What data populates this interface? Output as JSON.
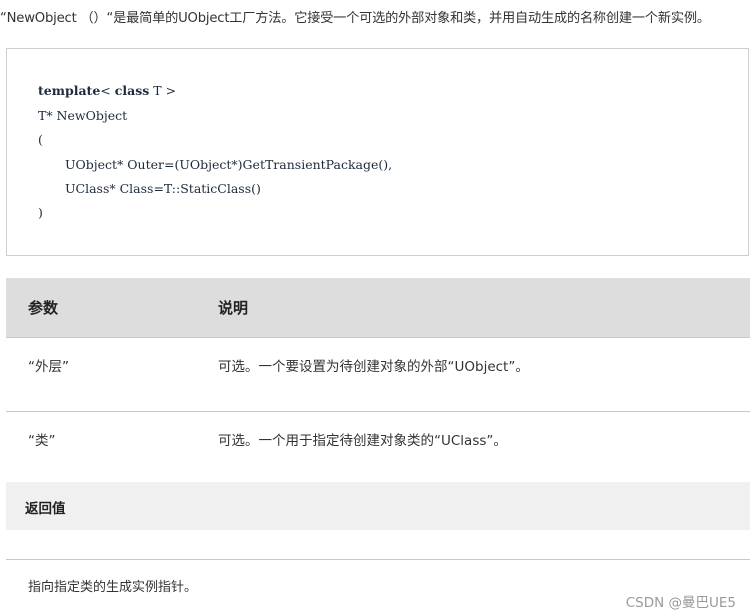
{
  "intro": "“NewObject （）“是最简单的UObject工厂方法。它接受一个可选的外部对象和类，并用自动生成的名称创建一个新实例。",
  "code": {
    "line1_kw1": "template",
    "line1_mid": "< ",
    "line1_kw2": "class",
    "line1_end": " T >",
    "line2": "T* NewObject",
    "line3": "(",
    "line4": "UObject* Outer=(UObject*)GetTransientPackage(),",
    "line5": "UClass* Class=T::StaticClass()",
    "line6": ")"
  },
  "params": {
    "header_param": "参数",
    "header_desc": "说明",
    "rows": [
      {
        "name": "“外层”",
        "desc": "可选。一个要设置为待创建对象的外部“UObject”。"
      },
      {
        "name": "“类”",
        "desc": "可选。一个用于指定待创建对象类的“UClass”。"
      }
    ]
  },
  "return": {
    "header": "返回值",
    "text": "指向指定类的生成实例指针。"
  },
  "watermark": "CSDN @曼巴UE5"
}
